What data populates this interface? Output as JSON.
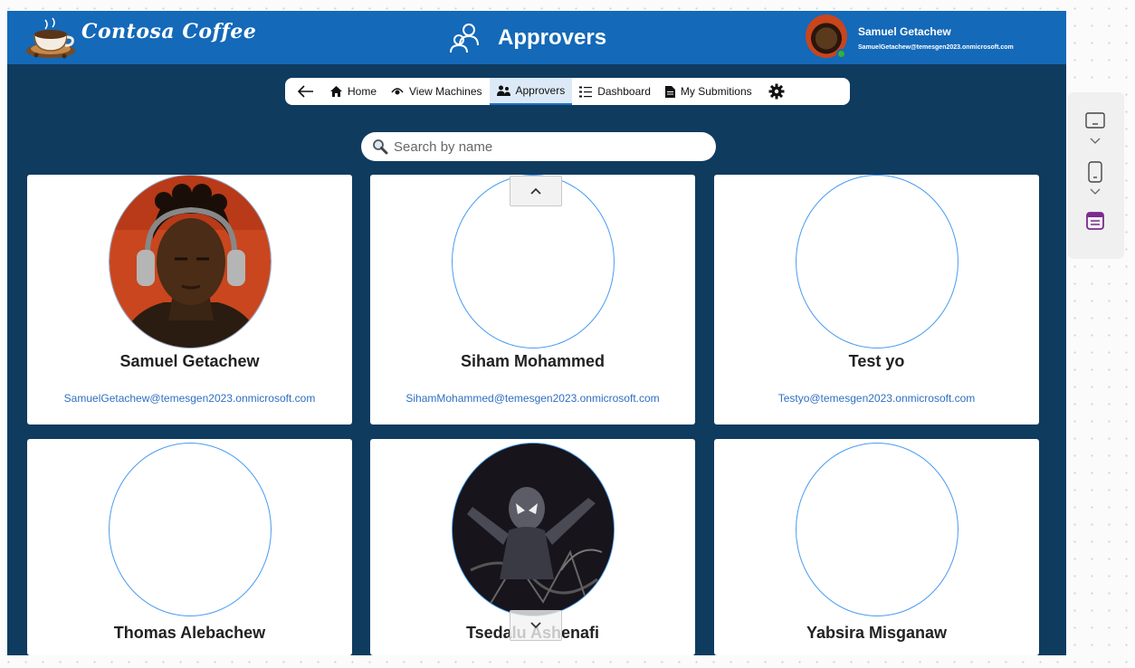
{
  "header": {
    "brand": "Contosa Coffee",
    "title": "Approvers",
    "user": {
      "name": "Samuel Getachew",
      "email": "SamuelGetachew@temesgen2023.onmicrosoft.com",
      "status": "available"
    }
  },
  "nav": {
    "items": [
      {
        "label": "Home",
        "icon": "home-icon"
      },
      {
        "label": "View Machines",
        "icon": "eye-icon"
      },
      {
        "label": "Approvers",
        "icon": "people-icon",
        "active": true
      },
      {
        "label": "Dashboard",
        "icon": "list-icon"
      },
      {
        "label": "My Submitions",
        "icon": "document-icon"
      }
    ]
  },
  "search": {
    "placeholder": "Search by name",
    "value": ""
  },
  "approvers": [
    {
      "name": "Samuel  Getachew",
      "email": "SamuelGetachew@temesgen2023.onmicrosoft.com",
      "photo": "man-with-headphones"
    },
    {
      "name": "Siham Mohammed",
      "email": "SihamMohammed@temesgen2023.onmicrosoft.com",
      "photo": null
    },
    {
      "name": "Test yo",
      "email": "Testyo@temesgen2023.onmicrosoft.com",
      "photo": null
    },
    {
      "name": "Thomas Alebachew",
      "email": "",
      "photo": null
    },
    {
      "name": "Tsedalu Ashenafi",
      "email": "",
      "photo": "spider-man-artwork"
    },
    {
      "name": "Yabsira Misganaw",
      "email": "",
      "photo": null
    }
  ],
  "colors": {
    "header": "#1469b8",
    "background": "#0f3b5f",
    "link": "#2f6fc2",
    "accent": "#1e6fc4"
  }
}
